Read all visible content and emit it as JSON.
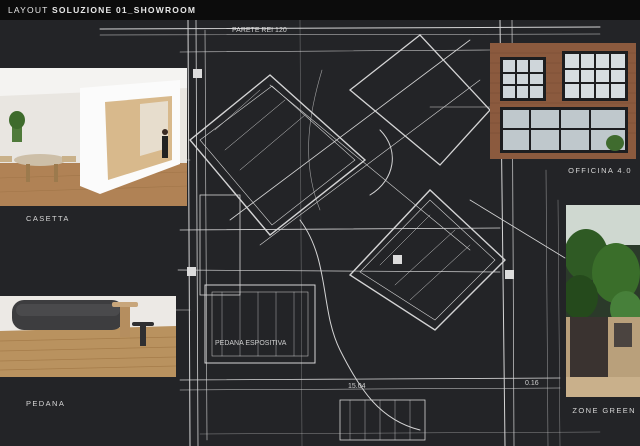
{
  "header": {
    "layout_label": "LAYOUT",
    "title": "SOLUZIONE 01_SHOWROOM"
  },
  "references": {
    "casetta": "CASETTA",
    "pedana": "PEDANA",
    "officina": "OFFICINA 4.0",
    "zone_green": "ZONE GREEN"
  },
  "sketch_notes": {
    "parete": "PARETE REI 120",
    "pedana_espositiva": "PEDANA ESPOSITIVA",
    "measure_a": "15.04",
    "measure_b": "0.16"
  },
  "colors": {
    "board": "#232427",
    "header_bg": "#0c0c0c",
    "chalk": "#e9e9e9",
    "text": "#d6d6d6"
  }
}
